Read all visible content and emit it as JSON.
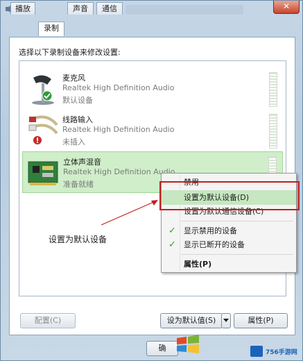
{
  "window": {
    "title": "声音",
    "close_glyph": "✕"
  },
  "tabs": [
    {
      "label": "播放"
    },
    {
      "label": "录制"
    },
    {
      "label": "声音"
    },
    {
      "label": "通信"
    }
  ],
  "instruction": "选择以下录制设备来修改设置:",
  "devices": [
    {
      "name": "麦克风",
      "driver": "Realtek High Definition Audio",
      "status": "默认设备",
      "icon": "microphone-icon"
    },
    {
      "name": "线路输入",
      "driver": "Realtek High Definition Audio",
      "status": "未插入",
      "icon": "line-in-icon"
    },
    {
      "name": "立体声混音",
      "driver": "Realtek High Definition Audio",
      "status": "准备就绪",
      "icon": "sound-card-icon"
    }
  ],
  "context_menu": {
    "items": [
      {
        "label": "禁用"
      },
      {
        "label": "设置为默认设备(D)"
      },
      {
        "label": "设置为默认通信设备(C)"
      },
      {
        "label": "显示禁用的设备",
        "checked": true
      },
      {
        "label": "显示已断开的设备",
        "checked": true
      },
      {
        "label": "属性(P)"
      }
    ]
  },
  "callout": "设置为默认设备",
  "buttons": {
    "configure": "配置(C)",
    "set_default": "设为默认值(S)",
    "properties": "属性(P)",
    "ok": "确"
  },
  "watermark": {
    "text": "756手游网"
  },
  "colors": {
    "selected_bg": "#cfeec9",
    "highlight": "#c6e7c0",
    "red_annotation": "#c41e1e"
  }
}
